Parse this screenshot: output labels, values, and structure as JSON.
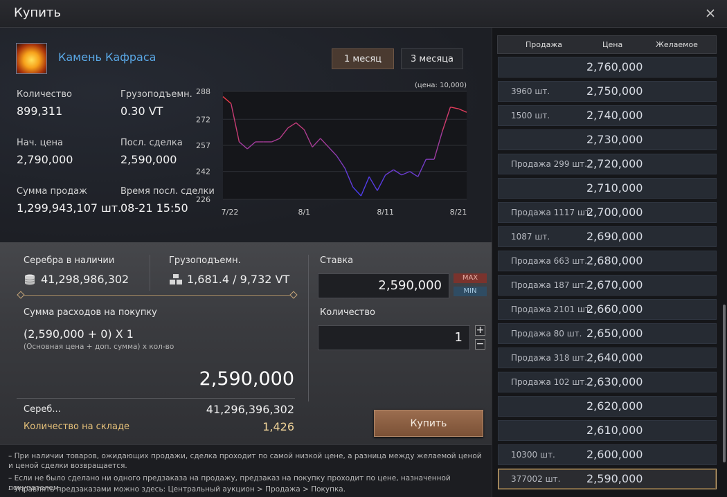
{
  "window": {
    "title": "Купить"
  },
  "item": {
    "name": "Камень Кафраса"
  },
  "period": {
    "one_month": "1 месяц",
    "three_months": "3 месяца"
  },
  "stats": {
    "quantity_label": "Количество",
    "quantity_value": "899,311",
    "weight_label": "Грузоподъемн.",
    "weight_value": "0.30 VT",
    "base_price_label": "Нач. цена",
    "base_price_value": "2,790,000",
    "last_deal_label": "Посл. сделка",
    "last_deal_value": "2,590,000",
    "sales_sum_label": "Сумма продаж",
    "sales_sum_value": "1,299,943,107 шт.",
    "last_deal_time_label": "Время посл. сделки",
    "last_deal_time_value": "08-21 15:50"
  },
  "chart_data": {
    "type": "line",
    "note": "(цена: 10,000)",
    "y_ticks": [
      "288",
      "272",
      "257",
      "242",
      "226"
    ],
    "x_ticks": [
      "7/22",
      "8/1",
      "8/11",
      "8/21"
    ],
    "ylim": [
      226,
      288
    ],
    "x": [
      0,
      1,
      2,
      3,
      4,
      5,
      6,
      7,
      8,
      9,
      10,
      11,
      12,
      13,
      14,
      15,
      16,
      17,
      18,
      19,
      20,
      21,
      22,
      23,
      24,
      25,
      26,
      27,
      28,
      29,
      30
    ],
    "values": [
      285,
      281,
      259,
      255,
      259,
      259,
      259,
      261,
      267,
      270,
      266,
      256,
      261,
      256,
      251,
      244,
      233,
      228,
      239,
      231,
      240,
      243,
      240,
      242,
      239,
      249,
      249,
      265,
      279,
      278,
      276
    ],
    "colors": {
      "up": "#e03a3a",
      "down": "#3a3ae0"
    }
  },
  "wallet": {
    "silver_label": "Серебра в наличии",
    "silver_value": "41,298,986,302",
    "weight_label": "Грузоподъемн.",
    "weight_value": "1,681.4 / 9,732 VT"
  },
  "cost": {
    "label": "Сумма расходов на покупку",
    "formula": "(2,590,000 + 0) X 1",
    "formula_hint": "(Основная цена + доп. сумма) х кол-во",
    "total": "2,590,000",
    "silver_after_label": "Сереб...",
    "silver_after_value": "41,296,396,302",
    "storage_label": "Количество на складе",
    "storage_value": "1,426"
  },
  "bid": {
    "label": "Ставка",
    "value": "2,590,000",
    "max_label": "MAX",
    "min_label": "MIN",
    "qty_label": "Количество",
    "qty_value": "1",
    "plus": "+",
    "minus": "−",
    "buy_label": "Купить"
  },
  "notes": [
    "– При наличии товаров, ожидающих продажи, сделка проходит по самой низкой цене, а разница между желаемой ценой и ценой сделки возвращается.",
    "– Если не было сделано ни одного предзаказа на продажу, предзаказ на покупку проходит по цене, назначенной покупателем.",
    "– Управлять предзаказами можно здесь: Центральный аукцион > Продажа > Покупка."
  ],
  "orders": {
    "headers": {
      "sell": "Продажа",
      "price": "Цена",
      "want": "Желаемое"
    },
    "rows": [
      {
        "qty": "",
        "price": "2,760,000"
      },
      {
        "qty": "3960 шт.",
        "price": "2,750,000"
      },
      {
        "qty": "1500 шт.",
        "price": "2,740,000"
      },
      {
        "qty": "",
        "price": "2,730,000"
      },
      {
        "qty": "Продажа 299 шт.",
        "price": "2,720,000"
      },
      {
        "qty": "",
        "price": "2,710,000"
      },
      {
        "qty": "Продажа 1117 шт.",
        "price": "2,700,000"
      },
      {
        "qty": "1087 шт.",
        "price": "2,690,000"
      },
      {
        "qty": "Продажа 663 шт.",
        "price": "2,680,000"
      },
      {
        "qty": "Продажа 187 шт.",
        "price": "2,670,000"
      },
      {
        "qty": "Продажа 2101 шт.",
        "price": "2,660,000"
      },
      {
        "qty": "Продажа 80 шт.",
        "price": "2,650,000"
      },
      {
        "qty": "Продажа 318 шт.",
        "price": "2,640,000"
      },
      {
        "qty": "Продажа 102 шт.",
        "price": "2,630,000"
      },
      {
        "qty": "",
        "price": "2,620,000"
      },
      {
        "qty": "",
        "price": "2,610,000"
      },
      {
        "qty": "10300 шт.",
        "price": "2,600,000"
      },
      {
        "qty": "377002 шт.",
        "price": "2,590,000",
        "selected": true
      }
    ]
  }
}
